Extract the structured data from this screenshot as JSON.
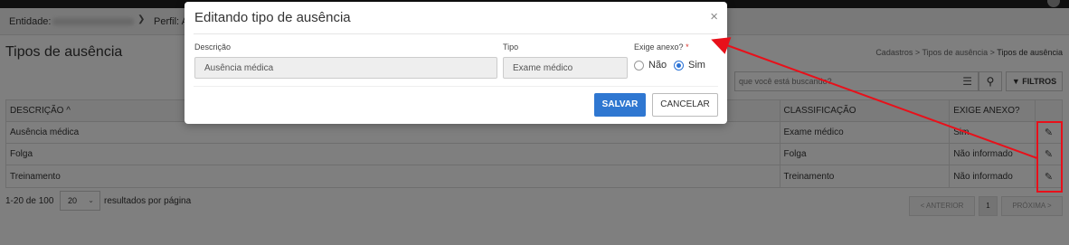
{
  "filterbar": {
    "entidade_label": "Entidade:",
    "perfil_label": "Perfil: A"
  },
  "page": {
    "title": "Tipos de ausência",
    "breadcrumb": [
      "Cadastros",
      "Tipos de ausência",
      "Tipos de ausência"
    ]
  },
  "search": {
    "placeholder": "que você está buscando?",
    "filters_label": "FILTROS"
  },
  "table": {
    "headers": [
      "DESCRIÇÃO ^",
      "CLASSIFICAÇÃO",
      "EXIGE ANEXO?"
    ],
    "rows": [
      {
        "descricao": "Ausência médica",
        "classificacao": "Exame médico",
        "exige": "Sim"
      },
      {
        "descricao": "Folga",
        "classificacao": "Folga",
        "exige": "Não informado"
      },
      {
        "descricao": "Treinamento",
        "classificacao": "Treinamento",
        "exige": "Não informado"
      }
    ]
  },
  "pagination": {
    "range": "1-20 de 100",
    "page_size": "20",
    "per_page_label": "resultados por página",
    "prev_label": "< ANTERIOR",
    "current_page": "1",
    "next_label": "PRÓXIMA >"
  },
  "modal": {
    "title": "Editando tipo de ausência",
    "close_glyph": "×",
    "descricao_label": "Descrição",
    "descricao_value": "Ausência médica",
    "tipo_label": "Tipo",
    "tipo_value": "Exame médico",
    "exige_label": "Exige anexo?",
    "required_mark": "*",
    "option_nao": "Não",
    "option_sim": "Sim",
    "selected_option": "Sim",
    "save_label": "SALVAR",
    "cancel_label": "CANCELAR"
  },
  "colors": {
    "primary": "#2f77d1",
    "annotation": "#e8101a",
    "overlay": "rgba(0,0,0,0.5)"
  }
}
